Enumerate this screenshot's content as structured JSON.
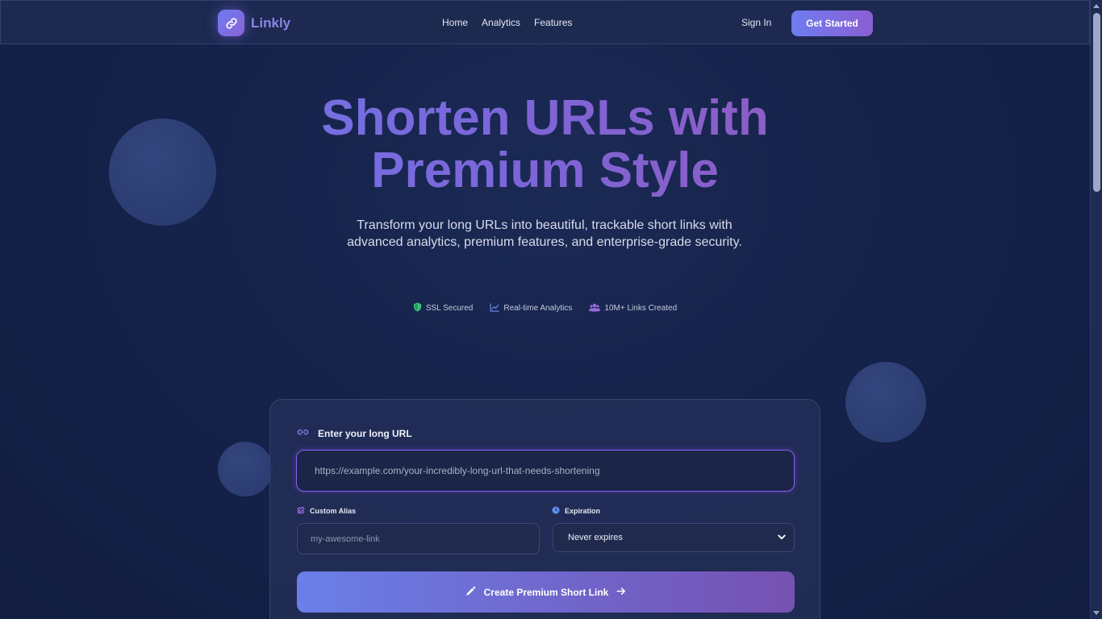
{
  "brand": {
    "name": "Linkly"
  },
  "nav": {
    "links": [
      "Home",
      "Analytics",
      "Features"
    ],
    "sign_in": "Sign In",
    "get_started": "Get Started"
  },
  "hero": {
    "title_line1_a": "Shorten ",
    "title_line1_b": "URLs with",
    "title_line2": "Premium Style",
    "subtitle": "Transform your long URLs into beautiful, trackable short links with advanced analytics, premium features, and enterprise-grade security.",
    "badges": [
      {
        "icon": "shield-icon",
        "label": "SSL Secured",
        "color": "#3bbf7a"
      },
      {
        "icon": "chart-line-icon",
        "label": "Real-time Analytics",
        "color": "#6e86e6"
      },
      {
        "icon": "users-icon",
        "label": "10M+ Links Created",
        "color": "#9a6ae0"
      }
    ]
  },
  "form": {
    "url_label": "Enter your long URL",
    "url_placeholder": "https://example.com/your-incredibly-long-url-that-needs-shortening",
    "alias_label": "Custom Alias",
    "alias_placeholder": "my-awesome-link",
    "expiration_label": "Expiration",
    "expiration_value": "Never expires",
    "submit_label": "Create Premium Short Link"
  },
  "colors": {
    "accent": "#8b5cf6",
    "brand_gradient_start": "#6d7df0",
    "brand_gradient_end": "#8a5fd3"
  }
}
